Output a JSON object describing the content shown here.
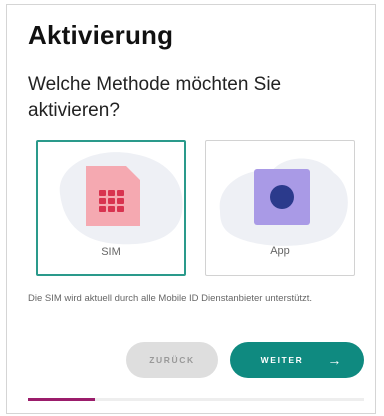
{
  "header": {
    "title": "Aktivierung"
  },
  "question": "Welche Methode möchten Sie aktivieren?",
  "options": [
    {
      "label": "SIM",
      "icon": "sim-card-icon",
      "selected": true
    },
    {
      "label": "App",
      "icon": "app-icon",
      "selected": false
    }
  ],
  "info_text": "Die SIM wird aktuell durch alle Mobile ID Dienstanbieter unterstützt.",
  "buttons": {
    "back_label": "ZURÜCK",
    "next_label": "WEITER",
    "next_arrow": "→"
  },
  "progress": {
    "fraction": 0.2
  },
  "colors": {
    "accent": "#0f8a80",
    "selected_border": "#2a9a8b",
    "progress": "#9b1d6b",
    "sim_icon": "#f5a9b1",
    "sim_chip": "#d8334f",
    "app_icon": "#a99ae6",
    "app_dot": "#2b3a8c"
  }
}
